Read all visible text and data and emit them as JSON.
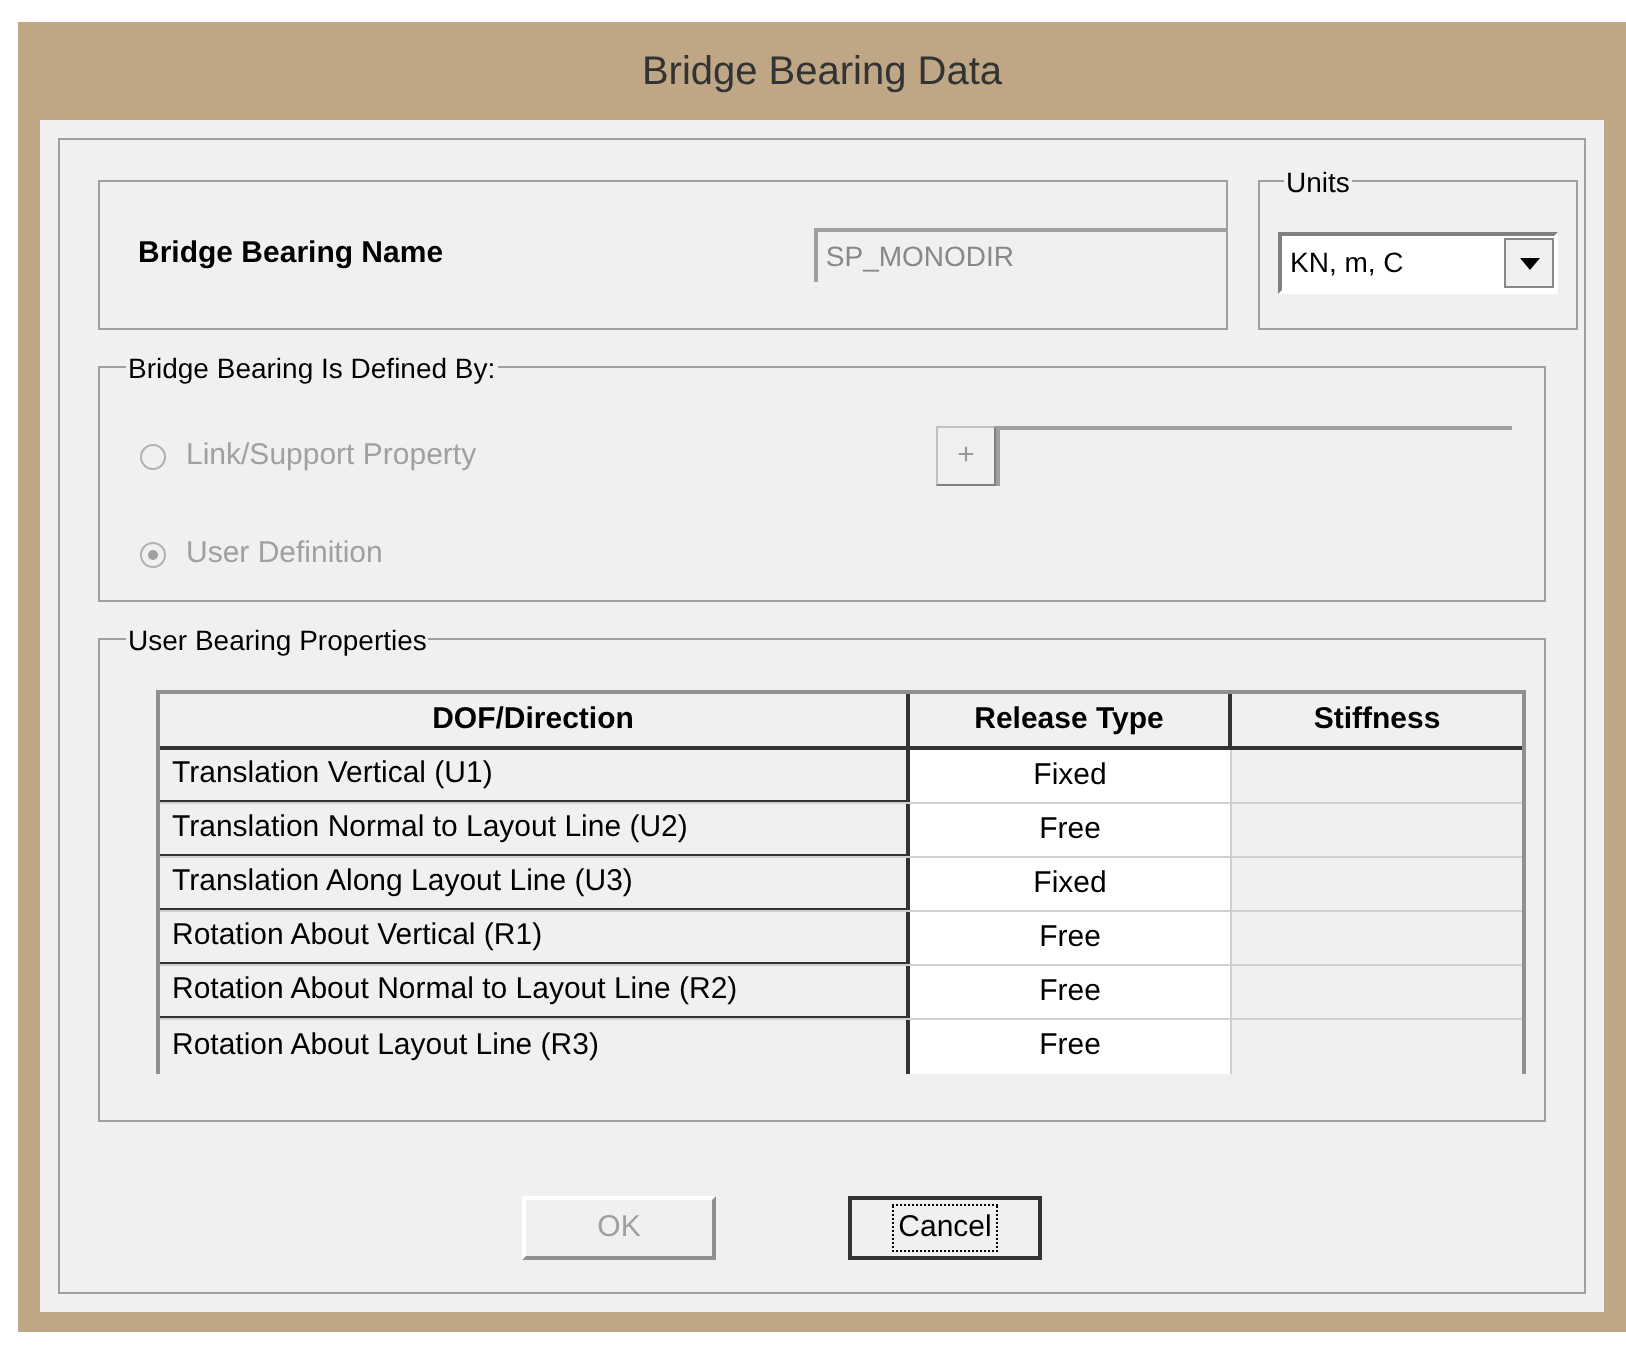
{
  "window": {
    "title": "Bridge Bearing Data"
  },
  "bearing_name": {
    "label": "Bridge Bearing Name",
    "value": "SP_MONODIR",
    "disabled": true
  },
  "units": {
    "label": "Units",
    "value": "KN, m, C"
  },
  "defined_by": {
    "label": "Bridge Bearing Is Defined By:",
    "plus_button": "+",
    "options": [
      {
        "label": "Link/Support Property",
        "selected": false,
        "disabled": true
      },
      {
        "label": "User Definition",
        "selected": true,
        "disabled": true
      }
    ]
  },
  "user_bearing_properties": {
    "label": "User Bearing Properties",
    "table": {
      "columns": [
        "DOF/Direction",
        "Release Type",
        "Stiffness"
      ],
      "rows": [
        {
          "dof": "Translation Vertical (U1)",
          "release_type": "Fixed"
        },
        {
          "dof": "Translation Normal to Layout Line (U2)",
          "release_type": "Free"
        },
        {
          "dof": "Translation Along Layout Line (U3)",
          "release_type": "Fixed"
        },
        {
          "dof": "Rotation About Vertical (R1)",
          "release_type": "Free"
        },
        {
          "dof": "Rotation About Normal to Layout Line (R2)",
          "release_type": "Free"
        },
        {
          "dof": "Rotation About Layout Line (R3)",
          "release_type": "Free"
        }
      ]
    }
  },
  "buttons": [
    {
      "label": "OK",
      "disabled": true,
      "focused": false
    },
    {
      "label": "Cancel",
      "disabled": false,
      "focused": true
    }
  ]
}
